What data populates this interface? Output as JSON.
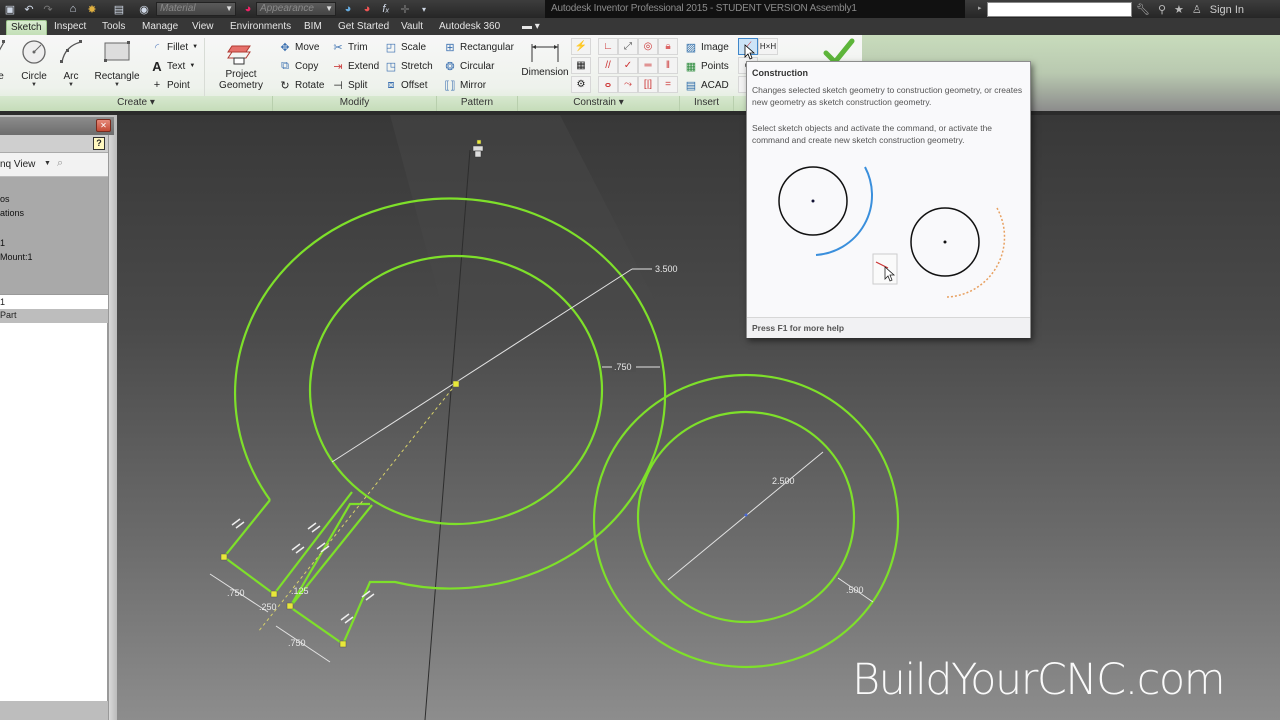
{
  "titlebar": {
    "title": "Autodesk Inventor Professional 2015 - STUDENT VERSION    Assembly1",
    "material_placeholder": "Material",
    "appearance_placeholder": "Appearance",
    "search_value": "",
    "sign_in": "Sign In",
    "quick_access_icons": [
      "new-icon",
      "undo-icon",
      "redo-icon",
      "home-icon",
      "open-icon",
      "update-icon",
      "color-wheel-icon",
      "appearance-adjust-icon",
      "clear-appearance-icon",
      "parameters-icon",
      "measure-icon"
    ],
    "right_icons": [
      "wrench-icon",
      "satellite-icon",
      "star-icon",
      "user-icon"
    ]
  },
  "tabs": [
    {
      "label": "Sketch",
      "active": true
    },
    {
      "label": "Inspect"
    },
    {
      "label": "Tools"
    },
    {
      "label": "Manage"
    },
    {
      "label": "View"
    },
    {
      "label": "Environments"
    },
    {
      "label": "BIM"
    },
    {
      "label": "Get Started"
    },
    {
      "label": "Vault"
    },
    {
      "label": "Autodesk 360"
    },
    {
      "label": "▾",
      "icon": "video-camera-icon"
    }
  ],
  "ribbon": {
    "create": {
      "label": "Create ▾",
      "line_partial": "e",
      "circle": "Circle",
      "arc": "Arc",
      "rectangle": "Rectangle",
      "fillet": "Fillet",
      "text": "Text",
      "point": "Point",
      "project_geometry_line1": "Project",
      "project_geometry_line2": "Geometry"
    },
    "modify": {
      "label": "Modify",
      "move": "Move",
      "copy": "Copy",
      "rotate": "Rotate",
      "trim": "Trim",
      "extend": "Extend",
      "split": "Split",
      "scale": "Scale",
      "stretch": "Stretch",
      "offset": "Offset"
    },
    "pattern": {
      "label": "Pattern",
      "rectangular": "Rectangular",
      "circular": "Circular",
      "mirror": "Mirror"
    },
    "constrain": {
      "label": "Constrain ▾",
      "dimension": "Dimension"
    },
    "insert": {
      "label": "Insert",
      "image": "Image",
      "points": "Points",
      "acad": "ACAD"
    }
  },
  "tooltip": {
    "title": "Construction",
    "desc": "Changes selected sketch geometry to construction geometry, or creates new geometry as sketch construction geometry.",
    "instructions": "Select sketch objects and activate the command, or activate the command and create new sketch construction geometry.",
    "footer": "Press F1 for more help"
  },
  "browser": {
    "view_label": "nq View",
    "items": [
      "os",
      "ations",
      "",
      "1",
      "Mount:1"
    ],
    "selected_item": "1",
    "sub_item": "Part"
  },
  "dimensions": {
    "outer_diameter": "3.500",
    "ring_width_large": ".750",
    "inner_diameter_small": "2.500",
    "ring_width_small": ".500",
    "slot_offset": ".125",
    "slot_width": ".250",
    "slot_a": ".750",
    "slot_b": ".750"
  },
  "watermark": "BuildYourCNC.com",
  "colors": {
    "sketch_green": "#7ee02a",
    "ribbon_tab_active": "#c3dfb7",
    "construction_orange": "#e8a060",
    "tooltip_blue_arc": "#3a8fdc"
  }
}
